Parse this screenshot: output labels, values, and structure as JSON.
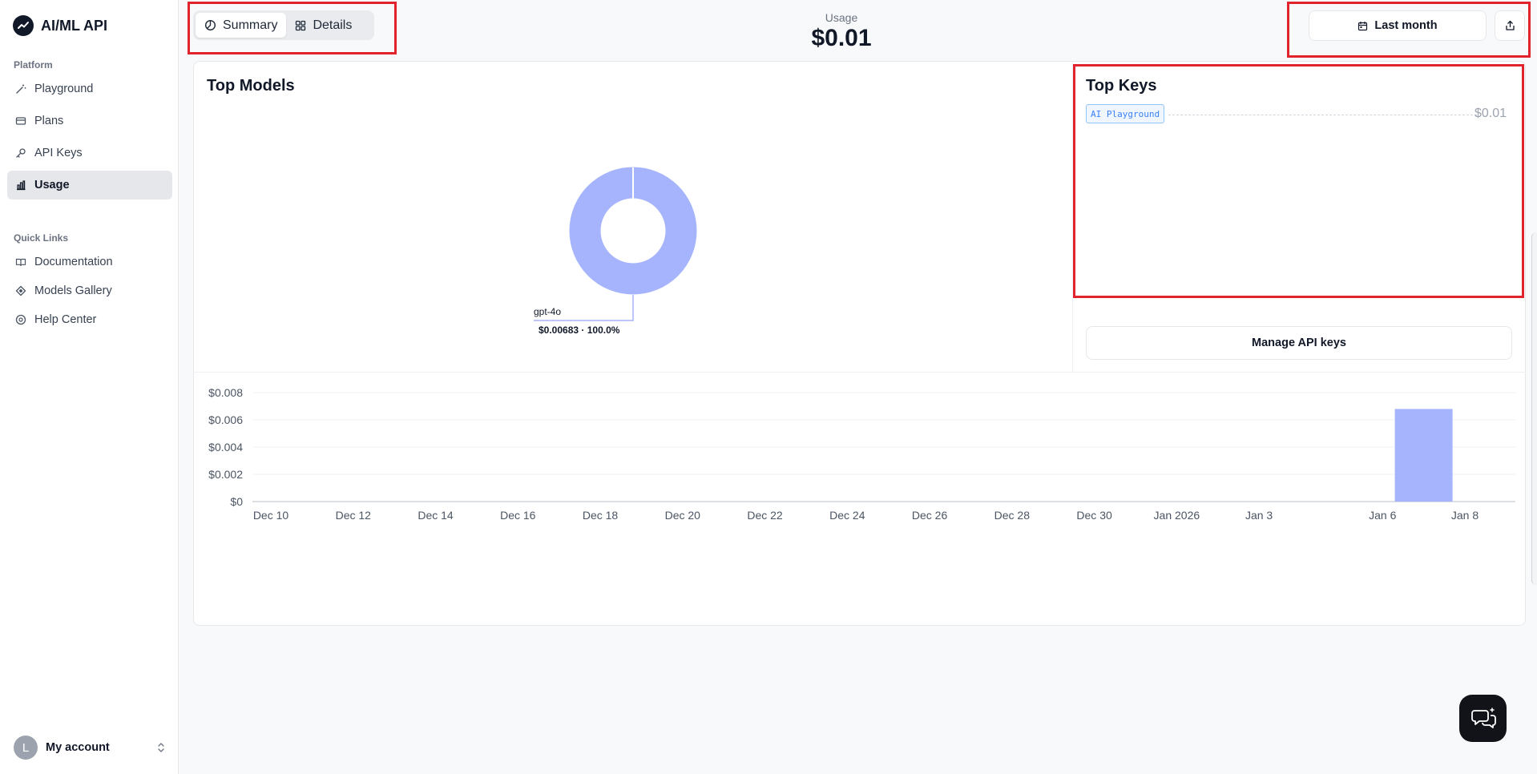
{
  "sidebar": {
    "brand": "AI/ML API",
    "platform_label": "Platform",
    "platform_items": [
      {
        "label": "Playground",
        "icon": "wand-icon"
      },
      {
        "label": "Plans",
        "icon": "card-icon"
      },
      {
        "label": "API Keys",
        "icon": "key-icon"
      },
      {
        "label": "Usage",
        "icon": "bar-chart-icon",
        "active": true
      }
    ],
    "quicklinks_label": "Quick Links",
    "quick_items": [
      {
        "label": "Documentation",
        "icon": "book-icon"
      },
      {
        "label": "Models Gallery",
        "icon": "diamond-icon"
      },
      {
        "label": "Help Center",
        "icon": "help-circle-icon"
      }
    ],
    "account": {
      "initial": "L",
      "name": "My account"
    }
  },
  "header": {
    "tabs": [
      {
        "label": "Summary",
        "icon": "pie-icon",
        "active": true
      },
      {
        "label": "Details",
        "icon": "grid-icon",
        "active": false
      }
    ],
    "usage_label": "Usage",
    "usage_value": "$0.01",
    "period_label": "Last month"
  },
  "top_models": {
    "title": "Top Models",
    "slices": [
      {
        "name": "gpt-4o",
        "value_label": "$0.00683 · 100.0%",
        "percent": 100.0
      }
    ]
  },
  "top_keys": {
    "title": "Top Keys",
    "keys": [
      {
        "name": "AI Playground",
        "value": "$0.01"
      }
    ],
    "manage_label": "Manage API keys"
  },
  "colors": {
    "accent": "#a5b4fc",
    "highlight": "#e0232d"
  },
  "chart_data": {
    "type": "bar",
    "categories": [
      "Jan 7"
    ],
    "values": [
      0.0068
    ],
    "x_tick_labels": [
      "Dec 10",
      "Dec 12",
      "Dec 14",
      "Dec 16",
      "Dec 18",
      "Dec 20",
      "Dec 22",
      "Dec 24",
      "Dec 26",
      "Dec 28",
      "Dec 30",
      "Jan 2026",
      "Jan 3",
      "Jan 6",
      "Jan 8"
    ],
    "y_tick_labels": [
      "$0.008",
      "$0.006",
      "$0.004",
      "$0.002",
      "$0"
    ],
    "ylim": [
      0,
      0.008
    ],
    "grid": true,
    "title": "",
    "xlabel": "",
    "ylabel": ""
  }
}
